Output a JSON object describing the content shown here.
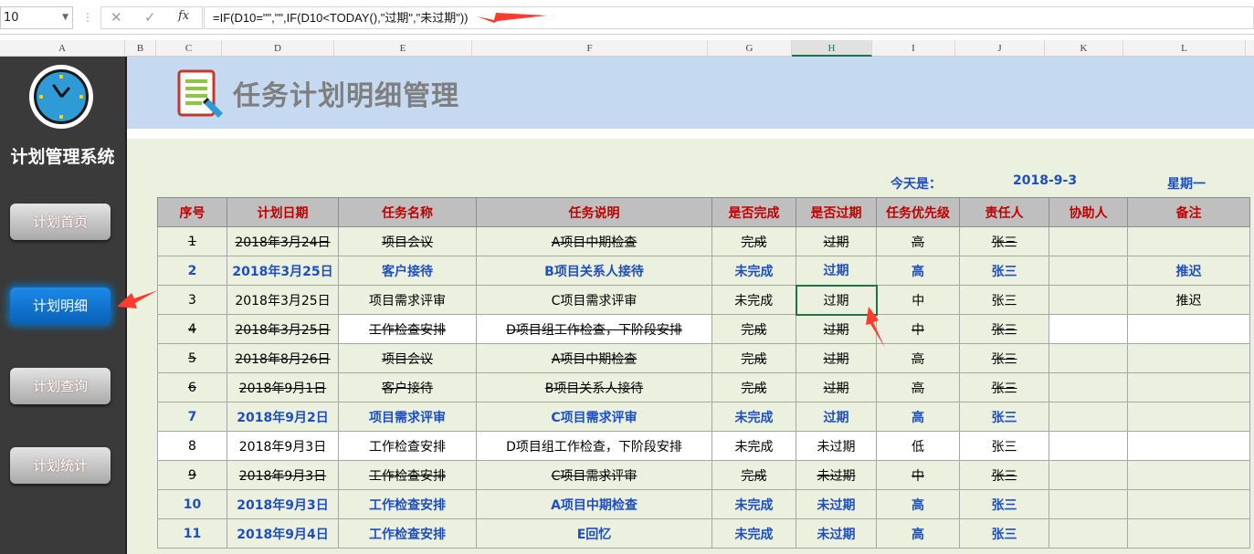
{
  "formula_bar": {
    "name_box": "10",
    "formula": "=IF(D10=\"\",\"\",IF(D10<TODAY(),\"过期\",\"未过期\"))",
    "cancel_icon": "✕",
    "enter_icon": "✓",
    "fx_label": "fx"
  },
  "columns": [
    "A",
    "B",
    "C",
    "D",
    "E",
    "F",
    "G",
    "H",
    "I",
    "J",
    "K",
    "L"
  ],
  "selected_column": "H",
  "sidebar": {
    "title": "计划管理系统",
    "logo_icon": "clock-icon",
    "items": [
      {
        "label": "计划首页",
        "active": false
      },
      {
        "label": "计划明细",
        "active": true
      },
      {
        "label": "计划查询",
        "active": false
      },
      {
        "label": "计划统计",
        "active": false
      }
    ]
  },
  "banner": {
    "title": "任务计划明细管理",
    "icon": "document-pencil-icon"
  },
  "today": {
    "label": "今天是：",
    "date": "2018-9-3",
    "weekday": "星期一"
  },
  "table": {
    "headers": [
      "序号",
      "计划日期",
      "任务名称",
      "任务说明",
      "是否完成",
      "是否过期",
      "任务优先级",
      "责任人",
      "协助人",
      "备注"
    ],
    "rows": [
      {
        "no": "1",
        "date": "2018年3月24日",
        "name": "项目会议",
        "desc": "A项目中期检查",
        "done": "完成",
        "expired": "过期",
        "priority": "高",
        "owner": "张三",
        "helper": "",
        "note": "",
        "status": "done",
        "bg": "g"
      },
      {
        "no": "2",
        "date": "2018年3月25日",
        "name": "客户接待",
        "desc": "B项目关系人接待",
        "done": "未完成",
        "expired": "过期",
        "priority": "高",
        "owner": "张三",
        "helper": "",
        "note": "推迟",
        "status": "pending",
        "bg": "g"
      },
      {
        "no": "3",
        "date": "2018年3月25日",
        "name": "项目需求评审",
        "desc": "C项目需求评审",
        "done": "未完成",
        "expired": "过期",
        "priority": "中",
        "owner": "张三",
        "helper": "",
        "note": "推迟",
        "status": "normal",
        "bg": "g"
      },
      {
        "no": "4",
        "date": "2018年3月25日",
        "name": "工作检查安排",
        "desc": "D项目组工作检查，下阶段安排",
        "done": "完成",
        "expired": "过期",
        "priority": "中",
        "owner": "张三",
        "helper": "",
        "note": "",
        "status": "done",
        "bg": "g",
        "white_cells": [
          "name",
          "desc",
          "helper",
          "note"
        ]
      },
      {
        "no": "5",
        "date": "2018年8月26日",
        "name": "项目会议",
        "desc": "A项目中期检查",
        "done": "完成",
        "expired": "过期",
        "priority": "高",
        "owner": "张三",
        "helper": "",
        "note": "",
        "status": "done",
        "bg": "g"
      },
      {
        "no": "6",
        "date": "2018年9月1日",
        "name": "客户接待",
        "desc": "B项目关系人接待",
        "done": "完成",
        "expired": "过期",
        "priority": "高",
        "owner": "张三",
        "helper": "",
        "note": "",
        "status": "done",
        "bg": "g"
      },
      {
        "no": "7",
        "date": "2018年9月2日",
        "name": "项目需求评审",
        "desc": "C项目需求评审",
        "done": "未完成",
        "expired": "过期",
        "priority": "高",
        "owner": "张三",
        "helper": "",
        "note": "",
        "status": "pending",
        "bg": "g"
      },
      {
        "no": "8",
        "date": "2018年9月3日",
        "name": "工作检查安排",
        "desc": "D项目组工作检查，下阶段安排",
        "done": "未完成",
        "expired": "未过期",
        "priority": "低",
        "owner": "张三",
        "helper": "",
        "note": "",
        "status": "normal",
        "bg": "w"
      },
      {
        "no": "9",
        "date": "2018年9月3日",
        "name": "工作检查安排",
        "desc": "C项目需求评审",
        "done": "完成",
        "expired": "未过期",
        "priority": "中",
        "owner": "张三",
        "helper": "",
        "note": "",
        "status": "done",
        "bg": "g"
      },
      {
        "no": "10",
        "date": "2018年9月3日",
        "name": "工作检查安排",
        "desc": "A项目中期检查",
        "done": "未完成",
        "expired": "未过期",
        "priority": "高",
        "owner": "张三",
        "helper": "",
        "note": "",
        "status": "pending",
        "bg": "g"
      },
      {
        "no": "11",
        "date": "2018年9月4日",
        "name": "工作检查安排",
        "desc": "E回忆",
        "done": "未完成",
        "expired": "未过期",
        "priority": "高",
        "owner": "张三",
        "helper": "",
        "note": "",
        "status": "pending",
        "bg": "g"
      }
    ]
  },
  "colors": {
    "accent_blue": "#1f4fbf",
    "header_red": "#c00000",
    "sheet_green": "#ebf1de",
    "banner_blue": "#c5d9f1",
    "sidebar_dark": "#3a3a3a",
    "arrow_red": "#ff3b30"
  }
}
